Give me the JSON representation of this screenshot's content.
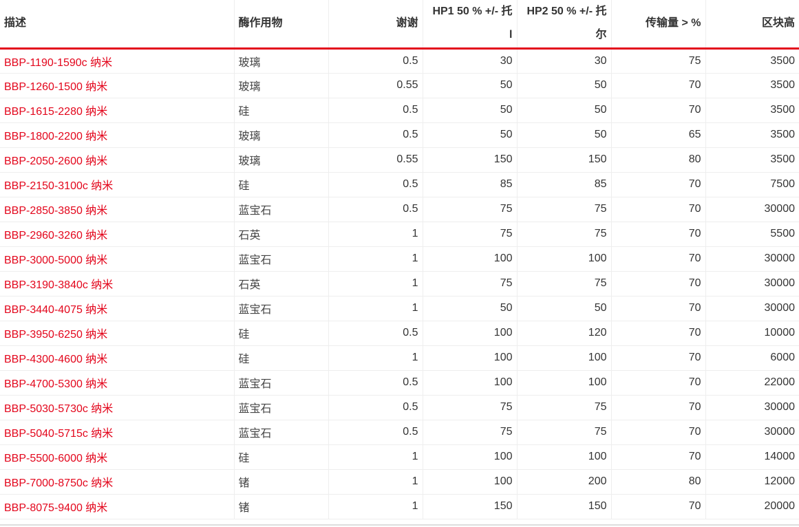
{
  "table": {
    "headers": [
      "描述",
      "酶作用物",
      "谢谢",
      "HP1 50 % +/- 托 l",
      "HP2 50 % +/- 托 尔",
      "传输量 > %",
      "区块高"
    ],
    "rows": [
      [
        "BBP-1190-1590c 纳米",
        "玻璃",
        "0.5",
        "30",
        "30",
        "75",
        "3500"
      ],
      [
        "BBP-1260-1500 纳米",
        "玻璃",
        "0.55",
        "50",
        "50",
        "70",
        "3500"
      ],
      [
        "BBP-1615-2280 纳米",
        "硅",
        "0.5",
        "50",
        "50",
        "70",
        "3500"
      ],
      [
        "BBP-1800-2200 纳米",
        "玻璃",
        "0.5",
        "50",
        "50",
        "65",
        "3500"
      ],
      [
        "BBP-2050-2600 纳米",
        "玻璃",
        "0.55",
        "150",
        "150",
        "80",
        "3500"
      ],
      [
        "BBP-2150-3100c 纳米",
        "硅",
        "0.5",
        "85",
        "85",
        "70",
        "7500"
      ],
      [
        "BBP-2850-3850 纳米",
        "蓝宝石",
        "0.5",
        "75",
        "75",
        "70",
        "30000"
      ],
      [
        "BBP-2960-3260 纳米",
        "石英",
        "1",
        "75",
        "75",
        "70",
        "5500"
      ],
      [
        "BBP-3000-5000 纳米",
        "蓝宝石",
        "1",
        "100",
        "100",
        "70",
        "30000"
      ],
      [
        "BBP-3190-3840c 纳米",
        "石英",
        "1",
        "75",
        "75",
        "70",
        "30000"
      ],
      [
        "BBP-3440-4075 纳米",
        "蓝宝石",
        "1",
        "50",
        "50",
        "70",
        "30000"
      ],
      [
        "BBP-3950-6250 纳米",
        "硅",
        "0.5",
        "100",
        "120",
        "70",
        "10000"
      ],
      [
        "BBP-4300-4600 纳米",
        "硅",
        "1",
        "100",
        "100",
        "70",
        "6000"
      ],
      [
        "BBP-4700-5300 纳米",
        "蓝宝石",
        "0.5",
        "100",
        "100",
        "70",
        "22000"
      ],
      [
        "BBP-5030-5730c 纳米",
        "蓝宝石",
        "0.5",
        "75",
        "75",
        "70",
        "30000"
      ],
      [
        "BBP-5040-5715c 纳米",
        "蓝宝石",
        "0.5",
        "75",
        "75",
        "70",
        "30000"
      ],
      [
        "BBP-5500-6000 纳米",
        "硅",
        "1",
        "100",
        "100",
        "70",
        "14000"
      ],
      [
        "BBP-7000-8750c 纳米",
        "锗",
        "1",
        "100",
        "200",
        "80",
        "12000"
      ],
      [
        "BBP-8075-9400 纳米",
        "锗",
        "1",
        "150",
        "150",
        "70",
        "20000"
      ]
    ]
  },
  "colors": {
    "accent": "#e3051b",
    "text": "#333333",
    "grid": "#eeeeee"
  }
}
